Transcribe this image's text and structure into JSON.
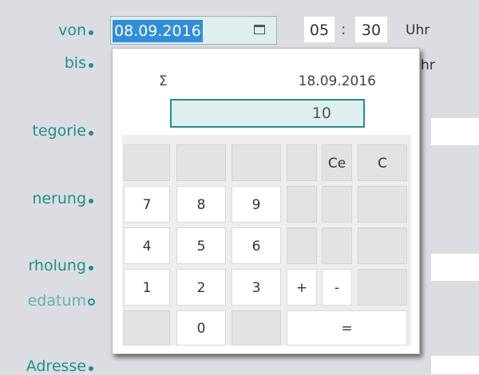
{
  "form": {
    "labels": {
      "von": "von",
      "bis": "bis",
      "kategorie": "tegorie",
      "erinnerung": "nerung",
      "wiederholung": "rholung",
      "enddatum": "edatum",
      "adresse": "Adresse"
    },
    "date_value": "08.09.2016",
    "hour": "05",
    "minute": "30",
    "time_separator": ":",
    "uhr_label": "Uhr",
    "uhr_label_partial": "hr"
  },
  "calculator": {
    "sigma": "Σ",
    "reference_date": "18.09.2016",
    "display_value": "10",
    "keys": {
      "ce": "Ce",
      "c": "C",
      "seven": "7",
      "eight": "8",
      "nine": "9",
      "four": "4",
      "five": "5",
      "six": "6",
      "one": "1",
      "two": "2",
      "three": "3",
      "plus": "+",
      "minus": "-",
      "zero": "0",
      "equals": "="
    }
  }
}
